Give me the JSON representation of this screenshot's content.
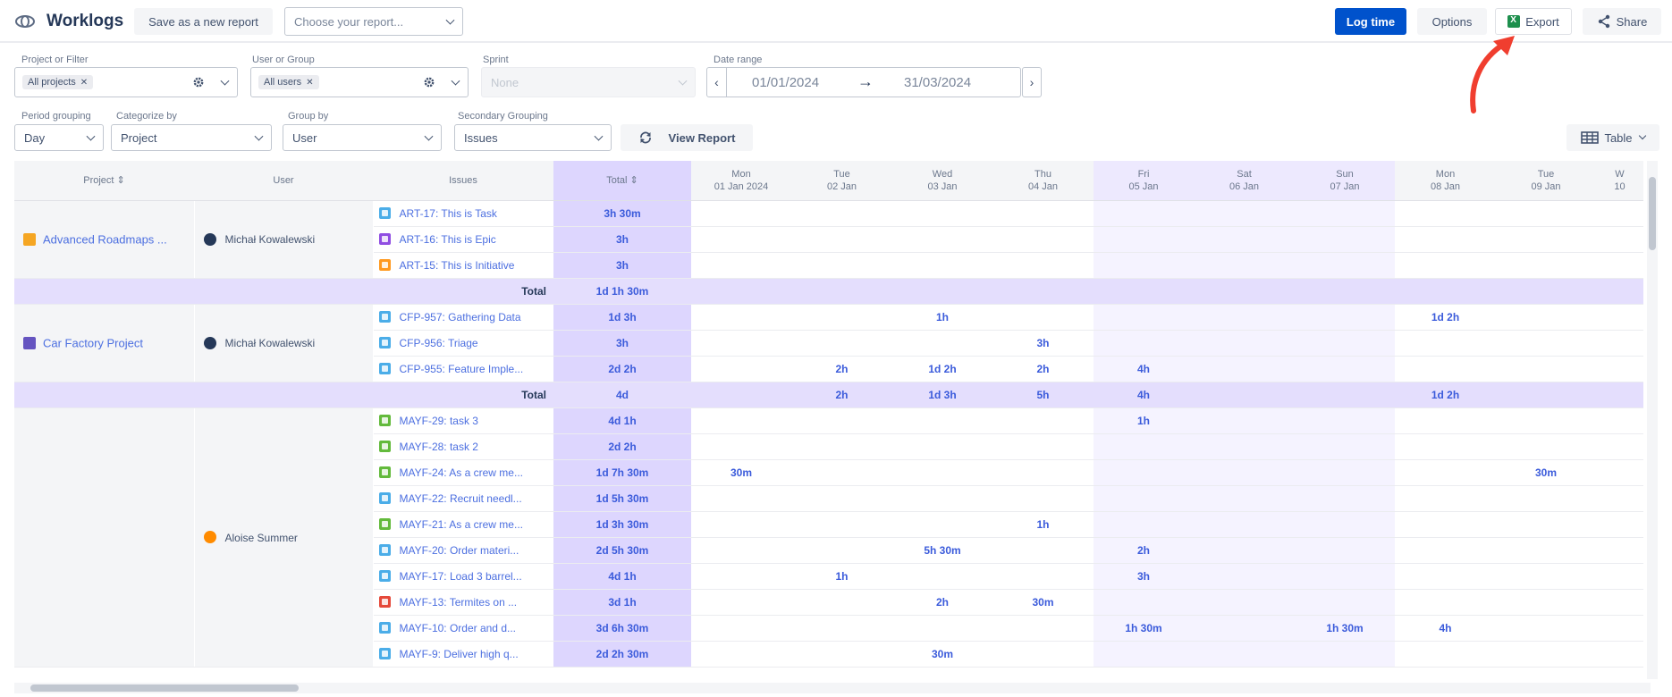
{
  "header": {
    "title": "Worklogs",
    "save_report": "Save as a new report",
    "choose_report_placeholder": "Choose your report...",
    "log_time": "Log time",
    "options": "Options",
    "export": "Export",
    "share": "Share"
  },
  "filters": {
    "project_label": "Project or Filter",
    "project_chip": "All projects",
    "user_label": "User or Group",
    "user_chip": "All users",
    "sprint_label": "Sprint",
    "sprint_value": "None",
    "date_label": "Date range",
    "date_from": "01/01/2024",
    "date_to": "31/03/2024",
    "period_label": "Period grouping",
    "period_value": "Day",
    "categorize_label": "Categorize by",
    "categorize_value": "Project",
    "group_label": "Group by",
    "group_value": "User",
    "secondary_label": "Secondary Grouping",
    "secondary_value": "Issues",
    "view_report": "View Report",
    "table_view": "Table"
  },
  "colors": {
    "primary": "#0052cc",
    "total_column": "#ddd6fe",
    "weekend_column": "#f5f3ff",
    "link": "#4c6fe0"
  },
  "grid": {
    "headers": {
      "project": "Project",
      "user": "User",
      "issues": "Issues",
      "total": "Total"
    },
    "days": [
      {
        "dow": "Mon",
        "date": "01 Jan 2024",
        "weekend": false
      },
      {
        "dow": "Tue",
        "date": "02 Jan",
        "weekend": false
      },
      {
        "dow": "Wed",
        "date": "03 Jan",
        "weekend": false
      },
      {
        "dow": "Thu",
        "date": "04 Jan",
        "weekend": false
      },
      {
        "dow": "Fri",
        "date": "05 Jan",
        "weekend": true
      },
      {
        "dow": "Sat",
        "date": "06 Jan",
        "weekend": true
      },
      {
        "dow": "Sun",
        "date": "07 Jan",
        "weekend": true
      },
      {
        "dow": "Mon",
        "date": "08 Jan",
        "weekend": false
      },
      {
        "dow": "Tue",
        "date": "09 Jan",
        "weekend": false
      },
      {
        "dow": "W",
        "date": "10",
        "weekend": false
      }
    ],
    "total_row_label": "Total",
    "groups": [
      {
        "project": "Advanced Roadmaps ...",
        "project_color": "#f5a623",
        "user": "Michał Kowalewski",
        "avatar_color": "#253858",
        "issues": [
          {
            "key": "ART-17: This is Task",
            "type": "task",
            "total": "3h 30m",
            "days": [
              "",
              "",
              "",
              "",
              "",
              "",
              "",
              "",
              "",
              ""
            ]
          },
          {
            "key": "ART-16: This is Epic",
            "type": "epic",
            "total": "3h",
            "days": [
              "",
              "",
              "",
              "",
              "",
              "",
              "",
              "",
              "",
              ""
            ]
          },
          {
            "key": "ART-15: This is Initiative",
            "type": "initiative",
            "total": "3h",
            "days": [
              "",
              "",
              "",
              "",
              "",
              "",
              "",
              "",
              "",
              ""
            ]
          }
        ],
        "sum": {
          "total": "1d 1h 30m",
          "days": [
            "",
            "",
            "",
            "",
            "",
            "",
            "",
            "",
            "",
            ""
          ]
        }
      },
      {
        "project": "Car Factory Project",
        "project_color": "#6554c0",
        "user": "Michał Kowalewski",
        "avatar_color": "#253858",
        "issues": [
          {
            "key": "CFP-957: Gathering Data",
            "type": "subtask",
            "total": "1d 3h",
            "days": [
              "",
              "",
              "1h",
              "",
              "",
              "",
              "",
              "1d 2h",
              "",
              ""
            ]
          },
          {
            "key": "CFP-956: Triage",
            "type": "subtask",
            "total": "3h",
            "days": [
              "",
              "",
              "",
              "3h",
              "",
              "",
              "",
              "",
              "",
              ""
            ]
          },
          {
            "key": "CFP-955: Feature Imple...",
            "type": "task",
            "total": "2d 2h",
            "days": [
              "",
              "2h",
              "1d 2h",
              "2h",
              "4h",
              "",
              "",
              "",
              "",
              ""
            ]
          }
        ],
        "sum": {
          "total": "4d",
          "days": [
            "",
            "2h",
            "1d 3h",
            "5h",
            "4h",
            "",
            "",
            "1d 2h",
            "",
            ""
          ]
        }
      },
      {
        "project": "",
        "project_color": "",
        "user": "Aloise Summer",
        "avatar_color": "#ff8b00",
        "issues": [
          {
            "key": "MAYF-29: task 3",
            "type": "story",
            "total": "4d 1h",
            "days": [
              "",
              "",
              "",
              "",
              "1h",
              "",
              "",
              "",
              "",
              ""
            ]
          },
          {
            "key": "MAYF-28: task 2",
            "type": "story",
            "total": "2d 2h",
            "days": [
              "",
              "",
              "",
              "",
              "",
              "",
              "",
              "",
              "",
              ""
            ]
          },
          {
            "key": "MAYF-24: As a crew me...",
            "type": "story",
            "total": "1d 7h 30m",
            "days": [
              "30m",
              "",
              "",
              "",
              "",
              "",
              "",
              "",
              "30m",
              ""
            ]
          },
          {
            "key": "MAYF-22: Recruit needl...",
            "type": "task",
            "total": "1d 5h 30m",
            "days": [
              "",
              "",
              "",
              "",
              "",
              "",
              "",
              "",
              "",
              ""
            ]
          },
          {
            "key": "MAYF-21: As a crew me...",
            "type": "story",
            "total": "1d 3h 30m",
            "days": [
              "",
              "",
              "",
              "1h",
              "",
              "",
              "",
              "",
              "",
              ""
            ]
          },
          {
            "key": "MAYF-20: Order materi...",
            "type": "task",
            "total": "2d 5h 30m",
            "days": [
              "",
              "",
              "5h 30m",
              "",
              "2h",
              "",
              "",
              "",
              "",
              ""
            ]
          },
          {
            "key": "MAYF-17: Load 3 barrel...",
            "type": "task",
            "total": "4d 1h",
            "days": [
              "",
              "1h",
              "",
              "",
              "3h",
              "",
              "",
              "",
              "",
              ""
            ]
          },
          {
            "key": "MAYF-13: Termites on ...",
            "type": "bug",
            "total": "3d 1h",
            "days": [
              "",
              "",
              "2h",
              "30m",
              "",
              "",
              "",
              "",
              "",
              ""
            ]
          },
          {
            "key": "MAYF-10: Order and d...",
            "type": "task",
            "total": "3d 6h 30m",
            "days": [
              "",
              "",
              "",
              "",
              "1h 30m",
              "",
              "1h 30m",
              "4h",
              "",
              ""
            ]
          },
          {
            "key": "MAYF-9: Deliver high q...",
            "type": "task",
            "total": "2d 2h 30m",
            "days": [
              "",
              "",
              "30m",
              "",
              "",
              "",
              "",
              "",
              "",
              ""
            ]
          }
        ],
        "sum": null
      }
    ]
  }
}
